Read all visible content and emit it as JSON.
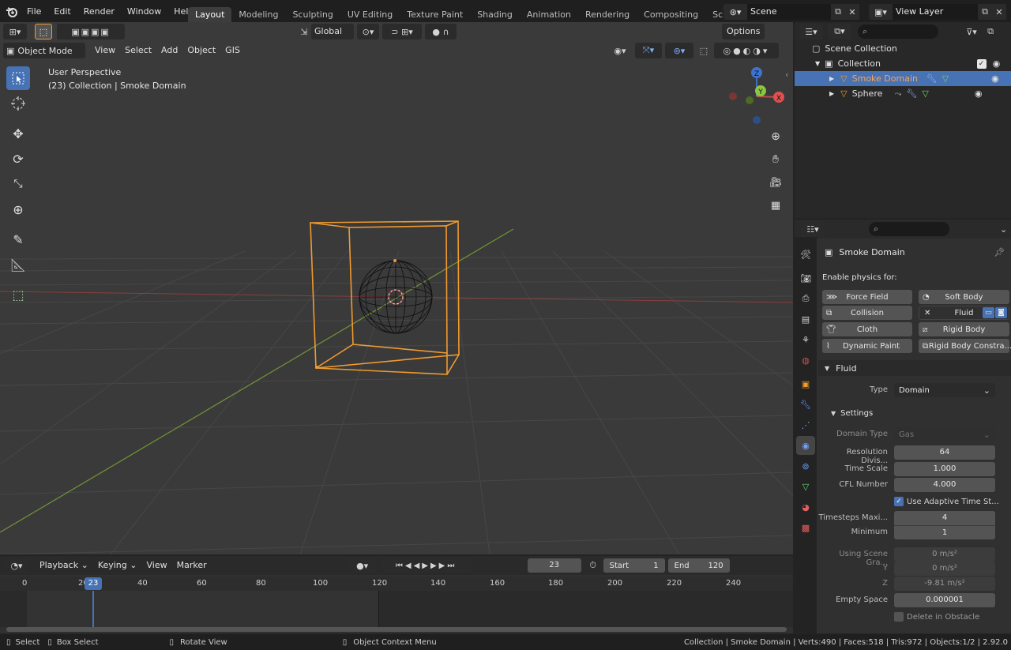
{
  "topbar": {
    "menus": [
      "File",
      "Edit",
      "Render",
      "Window",
      "Help"
    ],
    "workspaces": [
      "Layout",
      "Modeling",
      "Sculpting",
      "UV Editing",
      "Texture Paint",
      "Shading",
      "Animation",
      "Rendering",
      "Compositing",
      "Scripting"
    ],
    "add_tab": "+",
    "scene_name": "Scene",
    "view_layer": "View Layer"
  },
  "viewport": {
    "orientation": "Global",
    "options": "Options",
    "mode": "Object Mode",
    "menus": [
      "View",
      "Select",
      "Add",
      "Object",
      "GIS"
    ],
    "overlay_title": "User Perspective",
    "overlay_sub": "(23) Collection | Smoke Domain",
    "gizmo": {
      "z": "Z",
      "y": "Y",
      "x": "X"
    }
  },
  "outliner": {
    "rows": [
      {
        "label": "Scene Collection"
      },
      {
        "label": "Collection"
      },
      {
        "label": "Smoke Domain",
        "selected": true
      },
      {
        "label": "Sphere"
      }
    ]
  },
  "properties": {
    "object_name": "Smoke Domain",
    "enable_label": "Enable physics for:",
    "physics": [
      {
        "label": "Force Field"
      },
      {
        "label": "Soft Body"
      },
      {
        "label": "Collision"
      },
      {
        "label": "Fluid",
        "enabled": true
      },
      {
        "label": "Cloth"
      },
      {
        "label": "Rigid Body"
      },
      {
        "label": "Dynamic Paint"
      },
      {
        "label": "Rigid Body Constra..."
      }
    ],
    "fluid_header": "Fluid",
    "type_label": "Type",
    "type_value": "Domain",
    "settings_header": "Settings",
    "domain_type_label": "Domain Type",
    "domain_type_value": "Gas",
    "resolution_label": "Resolution Divis...",
    "resolution_value": "64",
    "time_scale_label": "Time Scale",
    "time_scale_value": "1.000",
    "cfl_label": "CFL Number",
    "cfl_value": "4.000",
    "adaptive_label": "Use Adaptive Time St...",
    "timesteps_max_label": "Timesteps Maxi...",
    "timesteps_max_value": "4",
    "minimum_label": "Minimum",
    "minimum_value": "1",
    "gravity_label": "Using Scene Gra...",
    "gravity_x": "0 m/s²",
    "y_label": "Y",
    "gravity_y": "0 m/s²",
    "z_label": "Z",
    "gravity_z": "-9.81 m/s²",
    "empty_space_label": "Empty Space",
    "empty_space_value": "0.000001",
    "delete_obstacle_label": "Delete in Obstacle"
  },
  "timeline": {
    "menus": [
      "Playback",
      "Keying",
      "View",
      "Marker"
    ],
    "current_frame": "23",
    "start_label": "Start",
    "start_value": "1",
    "end_label": "End",
    "end_value": "120",
    "ruler": [
      "0",
      "20",
      "40",
      "60",
      "80",
      "100",
      "120",
      "140",
      "160",
      "180",
      "200",
      "220",
      "240"
    ],
    "playhead": "23"
  },
  "status": {
    "select": "Select",
    "box_select": "Box Select",
    "rotate_view": "Rotate View",
    "context_menu": "Object Context Menu",
    "info": "Collection | Smoke Domain | Verts:490 | Faces:518 | Tris:972 | Objects:1/2 | 2.92.0"
  },
  "colors": {
    "accent": "#4772b3",
    "selection": "#f09a2e",
    "x_axis": "#b84848",
    "y_axis": "#7da83a"
  }
}
